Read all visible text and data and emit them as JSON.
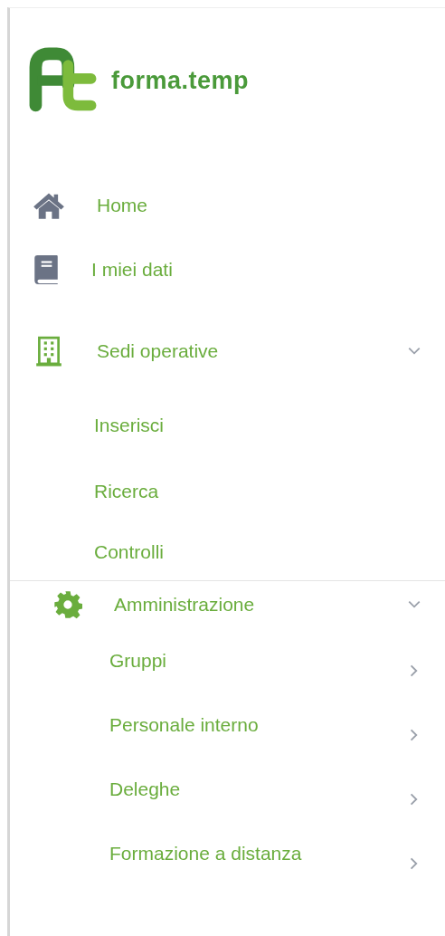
{
  "logo": {
    "text": "forma.temp"
  },
  "menu": [
    {
      "label": "Home"
    },
    {
      "label": "I miei dati"
    },
    {
      "label": "Sedi operative",
      "expanded": true,
      "children": [
        {
          "label": "Inserisci"
        },
        {
          "label": "Ricerca"
        },
        {
          "label": "Controlli"
        }
      ]
    }
  ],
  "admin": {
    "label": "Amministrazione",
    "expanded": true,
    "children": [
      {
        "label": "Gruppi",
        "expanded": false
      },
      {
        "label": "Personale interno",
        "expanded": false
      },
      {
        "label": "Deleghe",
        "expanded": false
      },
      {
        "label": "Formazione a distanza",
        "expanded": false
      }
    ]
  }
}
